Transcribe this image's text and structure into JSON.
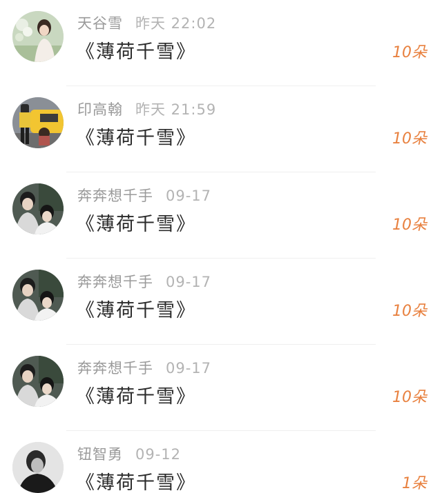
{
  "items": [
    {
      "name": "天谷雪",
      "time": "昨天 22:02",
      "title": "《薄荷千雪》",
      "amount": "10朵",
      "avatar_icon": "avatar-woman-flowers"
    },
    {
      "name": "印高翰",
      "time": "昨天 21:59",
      "title": "《薄荷千雪》",
      "amount": "10朵",
      "avatar_icon": "avatar-couple-taxi"
    },
    {
      "name": "奔奔想千手",
      "time": "09-17",
      "title": "《薄荷千雪》",
      "amount": "10朵",
      "avatar_icon": "avatar-two-men"
    },
    {
      "name": "奔奔想千手",
      "time": "09-17",
      "title": "《薄荷千雪》",
      "amount": "10朵",
      "avatar_icon": "avatar-two-men"
    },
    {
      "name": "奔奔想千手",
      "time": "09-17",
      "title": "《薄荷千雪》",
      "amount": "10朵",
      "avatar_icon": "avatar-two-men"
    },
    {
      "name": "钮智勇",
      "time": "09-12",
      "title": "《薄荷千雪》",
      "amount": "1朵",
      "avatar_icon": "avatar-bw-portrait"
    }
  ],
  "colors": {
    "amount": "#e8803e",
    "name": "#9a9a9a",
    "title": "#2b2b2b"
  }
}
